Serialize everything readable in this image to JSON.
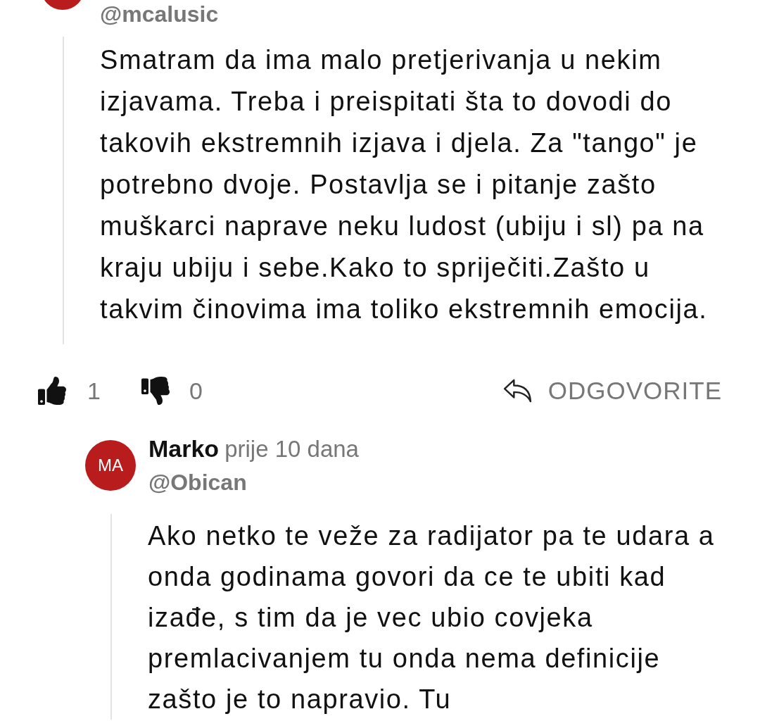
{
  "parent_comment": {
    "handle": "@mcalusic",
    "body": "Smatram da ima malo pretjerivanja u nekim izjavama. Treba i preispitati šta to dovodi do takovih ekstremnih izjava i djela. Za \"tango\" je potrebno dvoje. Postavlja se i pitanje zašto muškarci naprave neku ludost (ubiju i sl) pa na kraju ubiju i sebe.Kako to spriječiti.Zašto u takvim činovima ima toliko ekstremnih emocija.",
    "likes": "1",
    "dislikes": "0",
    "reply_label": "ODGOVORITE"
  },
  "reply": {
    "initials": "MA",
    "author": "Marko",
    "time": "prije 10 dana",
    "handle": "@Obican",
    "body": "Ako netko te veže za radijator pa te udara a onda godinama govori da ce te ubiti kad izađe, s tim da je vec ubio covjeka premlacivanjem tu onda nema definicije zašto je to napravio. Tu"
  }
}
